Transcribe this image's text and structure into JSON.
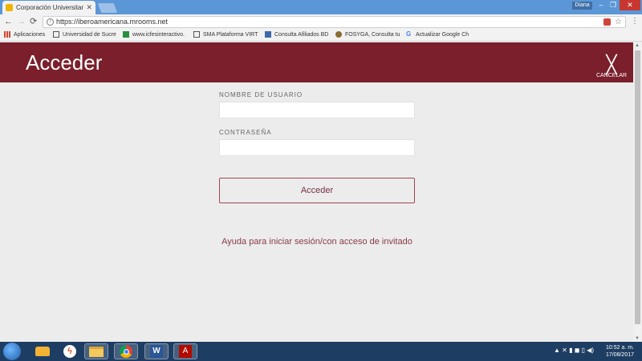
{
  "browser": {
    "tab_title": "Corporación Universitaria",
    "user": "Diana",
    "url": "https://iberoamericana.mrooms.net",
    "buttons": {
      "back": "←",
      "forward": "→",
      "reload": "⟳",
      "minimize": "–",
      "maximize": "❐",
      "close": "✕",
      "menu": "⋮",
      "star": "☆"
    },
    "bookmarks": [
      {
        "label": "Aplicaciones",
        "icon": "apps-grid-icon",
        "color": "#d4442f"
      },
      {
        "label": "Universidad de Sucre",
        "icon": "bookmark-icon",
        "color": "#555555"
      },
      {
        "label": "www.icfesinteractivo.",
        "icon": "bookmark-icon",
        "color": "#2a8f3a"
      },
      {
        "label": "SMA Plataforma VIRT",
        "icon": "bookmark-icon",
        "color": "#555555"
      },
      {
        "label": "Consulta Afiliados BD",
        "icon": "bookmark-icon",
        "color": "#3b6aa8"
      },
      {
        "label": "FOSYGA, Consulta tu",
        "icon": "bookmark-icon",
        "color": "#8a6d2f"
      },
      {
        "label": "Actualizar Google Ch",
        "icon": "google-icon",
        "color": "#4285f4"
      }
    ]
  },
  "page": {
    "title": "Acceder",
    "cancel_label": "CANCELAR",
    "cancel_icon": "close-icon",
    "username_label": "NOMBRE DE USUARIO",
    "username_value": "",
    "password_label": "CONTRASEÑA",
    "password_value": "",
    "login_button": "Acceder",
    "help_link": "Ayuda para iniciar sesión/con acceso de invitado"
  },
  "colors": {
    "header": "#7a1f2b",
    "accent": "#8a3a48"
  },
  "taskbar": {
    "apps": [
      "start-orb-icon",
      "cheese-icon",
      "flash-icon",
      "file-explorer-icon",
      "chrome-icon",
      "word-icon",
      "acrobat-icon"
    ],
    "time": "10:52 a. m.",
    "date": "17/08/2017"
  }
}
